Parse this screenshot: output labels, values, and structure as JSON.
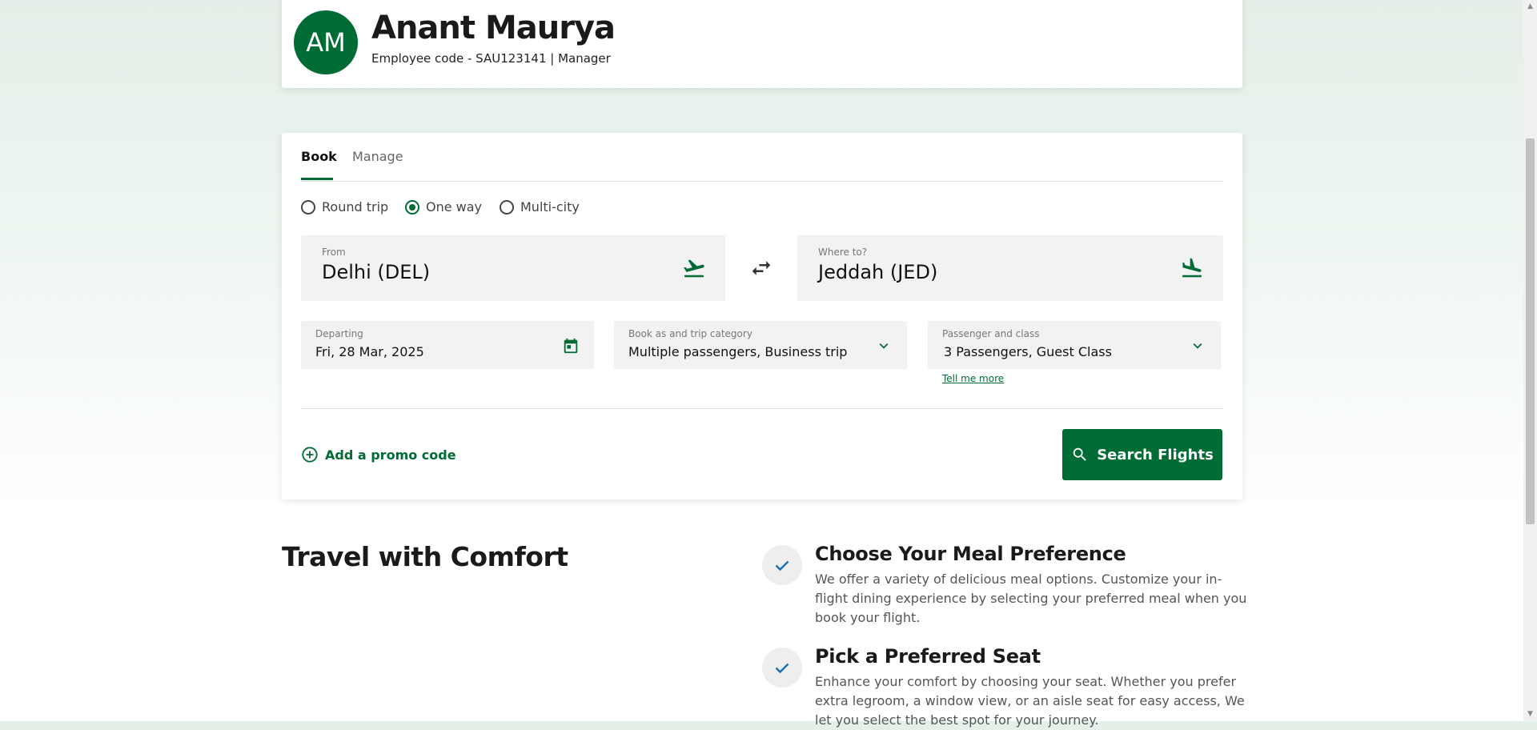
{
  "profile": {
    "initials": "AM",
    "name": "Anant Maurya",
    "code_line": "Employee code - SAU123141 | Manager"
  },
  "tabs": [
    {
      "label": "Book",
      "active": true
    },
    {
      "label": "Manage",
      "active": false
    }
  ],
  "trip_types": [
    {
      "label": "Round trip",
      "selected": false
    },
    {
      "label": "One way",
      "selected": true
    },
    {
      "label": "Multi-city",
      "selected": false
    }
  ],
  "from": {
    "label": "From",
    "value": "Delhi (DEL)",
    "icon": "departure-plane-icon"
  },
  "to": {
    "label": "Where to?",
    "value": "Jeddah (JED)",
    "icon": "arrival-plane-icon"
  },
  "swap_icon": "swap-arrows-icon",
  "departing": {
    "label": "Departing",
    "value": "Fri, 28 Mar, 2025",
    "icon": "calendar-icon"
  },
  "category": {
    "label": "Book as and trip category",
    "value": "Multiple passengers, Business trip",
    "icon": "chevron-down-icon"
  },
  "passengers": {
    "label": "Passenger and class",
    "value": "3 Passengers, Guest Class",
    "icon": "chevron-down-icon"
  },
  "tell_more": "Tell me more",
  "promo_label": "Add a promo code",
  "search_label": "Search Flights",
  "comfort": {
    "title": "Travel with Comfort",
    "features": [
      {
        "title": "Choose Your Meal Preference",
        "desc": "We offer a variety of delicious meal options. Customize your in-flight dining experience by selecting your preferred meal when you book your flight."
      },
      {
        "title": "Pick a Preferred Seat",
        "desc": "Enhance your comfort by choosing your seat. Whether you prefer extra legroom, a window view, or an aisle seat for easy access, We let you select the best spot for your journey."
      }
    ]
  },
  "colors": {
    "brand": "#006c35",
    "field_bg": "#f2f2f2",
    "check": "#1a6fb5"
  }
}
